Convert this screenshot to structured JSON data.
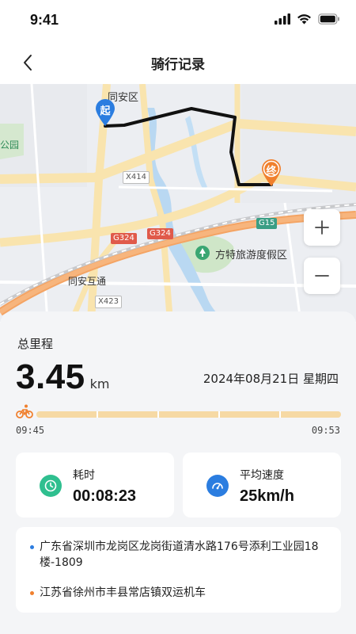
{
  "status_bar": {
    "time": "9:41"
  },
  "nav": {
    "title": "骑行记录",
    "back_icon": "chevron-left-icon"
  },
  "map": {
    "labels": {
      "district": "同安区",
      "park": "公园",
      "resort": "方特旅游度假区",
      "interchange": "同安互通"
    },
    "road_tags": {
      "x414": "X414",
      "g324_a": "G324",
      "g324_b": "G324",
      "g15": "G15",
      "x423": "X423"
    },
    "start_marker": "起",
    "end_marker": "终",
    "zoom_in": "+",
    "zoom_out": "−"
  },
  "summary": {
    "total_label": "总里程",
    "distance_value": "3.45",
    "distance_unit": "km",
    "date": "2024年08月21日  星期四",
    "start_time": "09:45",
    "end_time": "09:53",
    "progress_fraction": 1.0
  },
  "stats": {
    "duration_label": "耗时",
    "duration_value": "00:08:23",
    "speed_label": "平均速度",
    "speed_value": "25km/h"
  },
  "addresses": {
    "start": "广东省深圳市龙岗区龙岗街道清水路176号添利工业园18楼-1809",
    "end": "江苏省徐州市丰县常店镇双运机车"
  },
  "colors": {
    "start_marker": "#2b7de0",
    "end_marker": "#f0802e",
    "route": "#111111",
    "progress": "#f8e0b5",
    "duration_icon": "#2fbf8f",
    "speed_icon": "#2b7de0",
    "dot_start": "#2b7de0",
    "dot_end": "#f0802e"
  }
}
